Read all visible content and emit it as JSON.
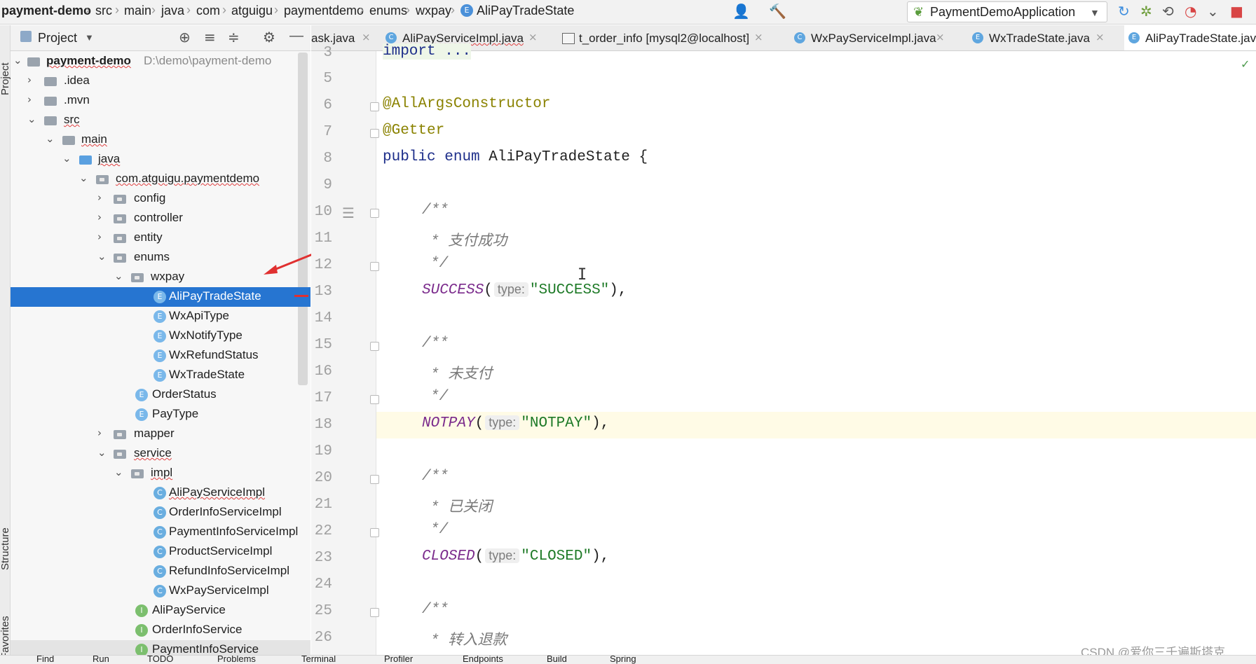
{
  "breadcrumb": [
    "payment-demo",
    "src",
    "main",
    "java",
    "com",
    "atguigu",
    "paymentdemo",
    "enums",
    "wxpay",
    "AliPayTradeState"
  ],
  "run_config": "PaymentDemoApplication",
  "project_panel": {
    "title": "Project"
  },
  "side_labels": {
    "project": "Project",
    "structure": "Structure",
    "favorites": "Favorites"
  },
  "tree": [
    {
      "label": "payment-demo",
      "path": "D:\\demo\\payment-demo"
    },
    {
      "label": ".idea"
    },
    {
      "label": ".mvn"
    },
    {
      "label": "src"
    },
    {
      "label": "main"
    },
    {
      "label": "java"
    },
    {
      "label": "com.atguigu.paymentdemo"
    },
    {
      "label": "config"
    },
    {
      "label": "controller"
    },
    {
      "label": "entity"
    },
    {
      "label": "enums"
    },
    {
      "label": "wxpay"
    },
    {
      "label": "AliPayTradeState"
    },
    {
      "label": "WxApiType"
    },
    {
      "label": "WxNotifyType"
    },
    {
      "label": "WxRefundStatus"
    },
    {
      "label": "WxTradeState"
    },
    {
      "label": "OrderStatus"
    },
    {
      "label": "PayType"
    },
    {
      "label": "mapper"
    },
    {
      "label": "service"
    },
    {
      "label": "impl"
    },
    {
      "label": "AliPayServiceImpl"
    },
    {
      "label": "OrderInfoServiceImpl"
    },
    {
      "label": "PaymentInfoServiceImpl"
    },
    {
      "label": "ProductServiceImpl"
    },
    {
      "label": "RefundInfoServiceImpl"
    },
    {
      "label": "WxPayServiceImpl"
    },
    {
      "label": "AliPayService"
    },
    {
      "label": "OrderInfoService"
    },
    {
      "label": "PaymentInfoService"
    }
  ],
  "tabs": [
    "ask.java",
    "AliPayServiceImpl.java",
    "t_order_info [mysql2@localhost]",
    "WxPayServiceImpl.java",
    "WxTradeState.java",
    "AliPayTradeState.java"
  ],
  "code": {
    "ln": [
      "3",
      "5",
      "6",
      "7",
      "8",
      "9",
      "10",
      "11",
      "12",
      "13",
      "14",
      "15",
      "16",
      "17",
      "18",
      "19",
      "20",
      "21",
      "22",
      "23",
      "24",
      "25",
      "26"
    ],
    "import": "import ...",
    "ann1": "@AllArgsConstructor",
    "ann2": "@Getter",
    "kw_public": "public",
    "kw_enum": "enum",
    "class_name": "AliPayTradeState {",
    "c_open": "/**",
    "c_close": "*/",
    "c1": "* 支付成功",
    "c2": "* 未支付",
    "c3": "* 已关闭",
    "c4": "* 转入退款",
    "hint": "type:",
    "e1": "SUCCESS",
    "s1": "\"SUCCESS\"",
    "e2": "NOTPAY",
    "s2": "\"NOTPAY\"",
    "e3": "CLOSED",
    "s3": "\"CLOSED\"",
    "paren_open": "(",
    "paren_close": "),"
  },
  "bottom_tabs": [
    "Find",
    "Run",
    "TODO",
    "Problems",
    "Terminal",
    "Profiler",
    "Endpoints",
    "Build",
    "Spring"
  ],
  "watermark": "CSDN @爱你三千遍斯塔克",
  "colors": {
    "selection": "#2675d1",
    "accent": "#4a86c8",
    "arrow": "#e03030"
  }
}
